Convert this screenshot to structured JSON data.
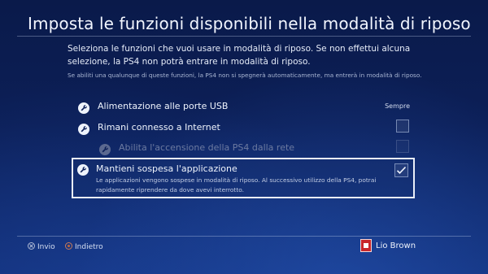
{
  "page": {
    "title": "Imposta le funzioni disponibili nella modalità di riposo",
    "description": "Seleziona le funzioni che vuoi usare in modalità di riposo. Se non effettui alcuna selezione, la PS4 non potrà entrare in modalità di riposo.",
    "note": "Se abiliti una qualunque di queste funzioni, la PS4 non si spegnerà automaticamente, ma entrerà in modalità di riposo."
  },
  "options": [
    {
      "label": "Alimentazione alle porte USB",
      "value": "Sempre",
      "icon": "wrench-icon"
    },
    {
      "label": "Rimani connesso a Internet",
      "checked": false,
      "icon": "wrench-icon"
    },
    {
      "label": "Abilita l'accensione della PS4 dalla rete",
      "checked": false,
      "enabled": false,
      "icon": "wrench-icon"
    },
    {
      "label": "Mantieni sospesa l'applicazione",
      "sub": "Le applicazioni vengono sospese in modalità di riposo. Al successivo utilizzo della PS4, potrai rapidamente riprendere da dove avevi interrotto.",
      "checked": true,
      "selected": true,
      "icon": "wrench-icon"
    }
  ],
  "footer": {
    "enter_label": "Invio",
    "back_label": "Indietro",
    "enter_icon": "cross-button-icon",
    "back_icon": "circle-button-icon",
    "user_name": "Lio Brown"
  },
  "colors": {
    "background": "#0c1f57",
    "accent": "#e9eef8"
  }
}
